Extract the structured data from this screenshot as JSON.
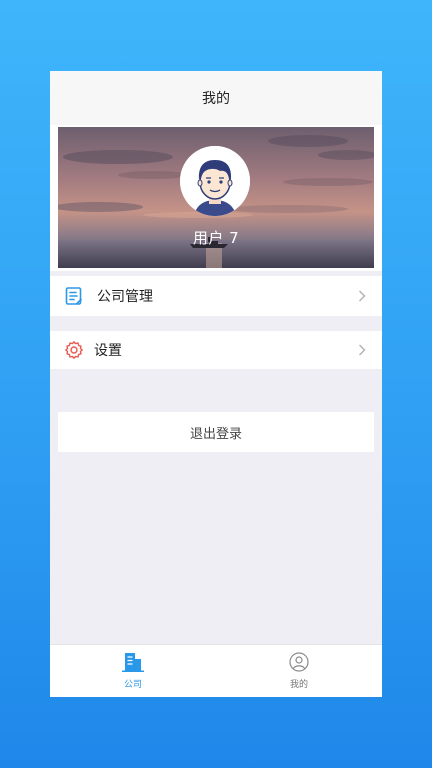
{
  "header": {
    "title": "我的"
  },
  "profile": {
    "username": "用户 7"
  },
  "menu": {
    "company_management": {
      "label": "公司管理",
      "icon": "document-icon",
      "icon_color": "#2a98e8"
    },
    "settings": {
      "label": "设置",
      "icon": "gear-icon",
      "icon_color": "#e85a4f"
    }
  },
  "logout": {
    "label": "退出登录"
  },
  "tabbar": {
    "company": {
      "label": "公司",
      "icon": "building-icon",
      "active": true
    },
    "mine": {
      "label": "我的",
      "icon": "user-icon",
      "active": false
    }
  },
  "colors": {
    "accent": "#2a98e8",
    "background": "#efeef4"
  }
}
